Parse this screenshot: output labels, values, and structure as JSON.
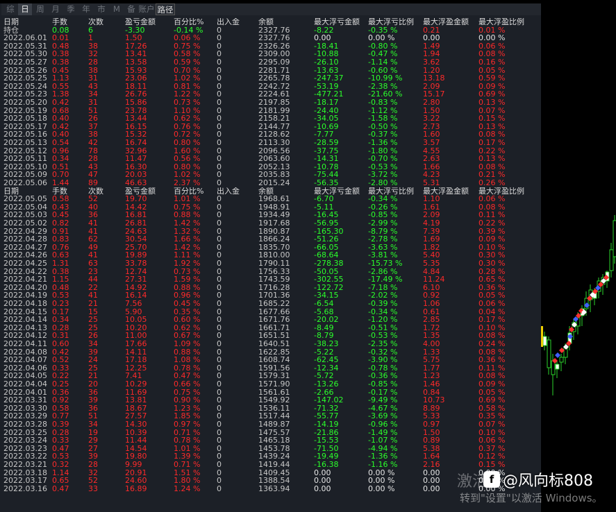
{
  "tabs": [
    {
      "label": "综",
      "active": false
    },
    {
      "label": "日",
      "active": true
    },
    {
      "label": "周",
      "active": false
    },
    {
      "label": "月",
      "active": false
    },
    {
      "label": "季",
      "active": false
    },
    {
      "label": "年",
      "active": false
    },
    {
      "label": "市",
      "active": false
    },
    {
      "label": "M",
      "active": false
    },
    {
      "label": "备",
      "active": false
    },
    {
      "label": "账户",
      "active": false
    },
    {
      "label": "路径",
      "active": false,
      "boxed": true
    }
  ],
  "columns": [
    "日期",
    "手数",
    "次数",
    "盈亏金额",
    "百分比%",
    "出入金",
    "余额",
    "最大浮亏金额",
    "最大浮亏比例",
    "最大浮盈金额",
    "最大浮盈比例"
  ],
  "holding_row": {
    "date": "持仓",
    "lots": "0.08",
    "count": "6",
    "pl": "-3.30",
    "pct": "-0.14 %",
    "io": "0",
    "balance": "2327.76",
    "max_loss": "-8.22",
    "max_loss_pct": "-0.35 %",
    "max_gain": "0.21",
    "max_gain_pct": "0.01 %"
  },
  "rows_a": [
    [
      "2022.06.01",
      "0.01",
      "1",
      "1.50",
      "0.06 %",
      "0",
      "2327.76",
      "0.00",
      "0.00 %",
      "0.00",
      "0.00 %"
    ],
    [
      "2022.05.31",
      "0.48",
      "38",
      "17.26",
      "0.75 %",
      "0",
      "2326.26",
      "-18.41",
      "-0.80 %",
      "1.49",
      "0.06 %"
    ],
    [
      "2022.05.30",
      "0.38",
      "32",
      "13.41",
      "0.58 %",
      "0",
      "2309.00",
      "-10.88",
      "-0.47 %",
      "1.94",
      "0.08 %"
    ],
    [
      "2022.05.27",
      "0.38",
      "28",
      "13.58",
      "0.59 %",
      "0",
      "2295.09",
      "-26.10",
      "-1.14 %",
      "3.62",
      "0.16 %"
    ],
    [
      "2022.05.26",
      "0.45",
      "38",
      "15.93",
      "0.70 %",
      "0",
      "2281.71",
      "-13.63",
      "-0.60 %",
      "1.20",
      "0.05 %"
    ],
    [
      "2022.05.25",
      "1.13",
      "31",
      "23.06",
      "1.02 %",
      "0",
      "2265.78",
      "-247.37",
      "-10.99 %",
      "13.18",
      "0.59 %"
    ],
    [
      "2022.05.24",
      "0.55",
      "43",
      "18.11",
      "0.81 %",
      "0",
      "2242.72",
      "-53.19",
      "-2.38 %",
      "2.09",
      "0.09 %"
    ],
    [
      "2022.05.23",
      "1.38",
      "34",
      "26.76",
      "1.22 %",
      "0",
      "2224.61",
      "-477.21",
      "-21.60 %",
      "15.17",
      "0.69 %"
    ],
    [
      "2022.05.20",
      "0.42",
      "31",
      "15.86",
      "0.73 %",
      "0",
      "2197.85",
      "-18.17",
      "-0.83 %",
      "2.80",
      "0.13 %"
    ],
    [
      "2022.05.19",
      "0.68",
      "51",
      "23.78",
      "1.10 %",
      "0",
      "2181.99",
      "-24.40",
      "-1.12 %",
      "1.50",
      "0.07 %"
    ],
    [
      "2022.05.18",
      "0.40",
      "26",
      "13.44",
      "0.62 %",
      "0",
      "2158.21",
      "-34.05",
      "-1.58 %",
      "3.22",
      "0.15 %"
    ],
    [
      "2022.05.17",
      "0.42",
      "37",
      "16.15",
      "0.76 %",
      "0",
      "2144.77",
      "-10.69",
      "-0.50 %",
      "2.73",
      "0.13 %"
    ],
    [
      "2022.05.16",
      "0.40",
      "38",
      "15.32",
      "0.72 %",
      "0",
      "2128.62",
      "-7.77",
      "-0.37 %",
      "1.60",
      "0.08 %"
    ],
    [
      "2022.05.13",
      "0.54",
      "42",
      "16.74",
      "0.80 %",
      "0",
      "2113.30",
      "-28.59",
      "-1.36 %",
      "3.57",
      "0.17 %"
    ],
    [
      "2022.05.12",
      "0.96",
      "78",
      "32.96",
      "1.60 %",
      "0",
      "2096.56",
      "-37.75",
      "-1.80 %",
      "4.55",
      "0.22 %"
    ],
    [
      "2022.05.11",
      "0.34",
      "28",
      "11.47",
      "0.56 %",
      "0",
      "2063.60",
      "-14.31",
      "-0.70 %",
      "2.63",
      "0.13 %"
    ],
    [
      "2022.05.10",
      "0.51",
      "43",
      "16.30",
      "0.80 %",
      "0",
      "2052.13",
      "-10.78",
      "-0.53 %",
      "1.66",
      "0.08 %"
    ],
    [
      "2022.05.09",
      "0.70",
      "47",
      "20.03",
      "1.02 %",
      "0",
      "2035.83",
      "-75.44",
      "-3.72 %",
      "4.23",
      "0.21 %"
    ],
    [
      "2022.05.06",
      "1.44",
      "89",
      "46.63",
      "2.37 %",
      "0",
      "2015.24",
      "-56.35",
      "-2.80 %",
      "5.31",
      "0.26 %"
    ]
  ],
  "rows_b": [
    [
      "2022.05.05",
      "0.58",
      "52",
      "19.70",
      "1.01 %",
      "0",
      "1968.61",
      "-6.70",
      "-0.34 %",
      "1.10",
      "0.06 %"
    ],
    [
      "2022.05.04",
      "0.43",
      "40",
      "14.42",
      "0.75 %",
      "0",
      "1948.91",
      "-5.11",
      "-0.26 %",
      "1.61",
      "0.08 %"
    ],
    [
      "2022.05.03",
      "0.45",
      "36",
      "16.81",
      "0.88 %",
      "0",
      "1934.49",
      "-16.45",
      "-0.85 %",
      "2.09",
      "0.11 %"
    ],
    [
      "2022.05.02",
      "0.82",
      "41",
      "26.81",
      "1.42 %",
      "0",
      "1917.68",
      "-56.95",
      "-2.99 %",
      "4.19",
      "0.22 %"
    ],
    [
      "2022.04.29",
      "0.91",
      "41",
      "24.63",
      "1.32 %",
      "0",
      "1890.87",
      "-165.30",
      "-8.79 %",
      "7.39",
      "0.39 %"
    ],
    [
      "2022.04.28",
      "0.83",
      "62",
      "30.54",
      "1.66 %",
      "0",
      "1866.24",
      "-51.26",
      "-2.78 %",
      "1.69",
      "0.09 %"
    ],
    [
      "2022.04.27",
      "0.76",
      "49",
      "25.70",
      "1.42 %",
      "0",
      "1835.70",
      "-66.05",
      "-3.63 %",
      "1.82",
      "0.10 %"
    ],
    [
      "2022.04.26",
      "0.63",
      "41",
      "19.89",
      "1.11 %",
      "0",
      "1810.00",
      "-68.64",
      "-3.81 %",
      "5.40",
      "0.30 %"
    ],
    [
      "2022.04.25",
      "1.31",
      "63",
      "33.78",
      "1.92 %",
      "0",
      "1790.11",
      "-278.38",
      "-15.73 %",
      "5.35",
      "0.30 %"
    ],
    [
      "2022.04.22",
      "0.38",
      "23",
      "12.74",
      "0.73 %",
      "0",
      "1756.33",
      "-50.05",
      "-2.86 %",
      "4.84",
      "0.28 %"
    ],
    [
      "2022.04.21",
      "1.15",
      "44",
      "27.31",
      "1.59 %",
      "0",
      "1743.59",
      "-302.55",
      "-17.49 %",
      "11.24",
      "0.65 %"
    ],
    [
      "2022.04.20",
      "0.48",
      "22",
      "14.92",
      "0.88 %",
      "0",
      "1716.28",
      "-122.72",
      "-7.18 %",
      "6.10",
      "0.36 %"
    ],
    [
      "2022.04.19",
      "0.53",
      "41",
      "16.14",
      "0.96 %",
      "0",
      "1701.36",
      "-34.15",
      "-2.02 %",
      "0.92",
      "0.05 %"
    ],
    [
      "2022.04.18",
      "0.23",
      "21",
      "7.56",
      "0.45 %",
      "0",
      "1685.22",
      "-6.54",
      "-0.39 %",
      "1.06",
      "0.06 %"
    ],
    [
      "2022.04.15",
      "0.17",
      "15",
      "5.90",
      "0.35 %",
      "0",
      "1677.66",
      "-5.68",
      "-0.34 %",
      "0.61",
      "0.04 %"
    ],
    [
      "2022.04.14",
      "0.34",
      "25",
      "10.05",
      "0.60 %",
      "0",
      "1671.76",
      "-20.02",
      "-1.20 %",
      "2.85",
      "0.17 %"
    ],
    [
      "2022.04.13",
      "0.28",
      "25",
      "10.20",
      "0.62 %",
      "0",
      "1661.71",
      "-8.49",
      "-0.51 %",
      "1.72",
      "0.10 %"
    ],
    [
      "2022.04.12",
      "0.31",
      "26",
      "11.00",
      "0.67 %",
      "0",
      "1651.51",
      "-8.79",
      "-0.53 %",
      "1.35",
      "0.08 %"
    ],
    [
      "2022.04.11",
      "0.60",
      "34",
      "17.66",
      "1.09 %",
      "0",
      "1640.51",
      "-38.23",
      "-2.35 %",
      "4.00",
      "0.24 %"
    ],
    [
      "2022.04.08",
      "0.42",
      "39",
      "14.11",
      "0.88 %",
      "0",
      "1622.85",
      "-5.22",
      "-0.32 %",
      "1.33",
      "0.08 %"
    ],
    [
      "2022.04.07",
      "0.52",
      "24",
      "17.18",
      "1.08 %",
      "0",
      "1608.74",
      "-62.45",
      "-3.90 %",
      "5.75",
      "0.36 %"
    ],
    [
      "2022.04.06",
      "0.33",
      "25",
      "12.25",
      "0.78 %",
      "0",
      "1591.56",
      "-12.34",
      "-0.78 %",
      "1.77",
      "0.11 %"
    ],
    [
      "2022.04.05",
      "0.22",
      "21",
      "7.41",
      "0.47 %",
      "0",
      "1579.31",
      "-5.72",
      "-0.36 %",
      "1.23",
      "0.08 %"
    ],
    [
      "2022.04.04",
      "0.25",
      "20",
      "10.29",
      "0.66 %",
      "0",
      "1571.90",
      "-13.26",
      "-0.85 %",
      "1.46",
      "0.09 %"
    ],
    [
      "2022.04.01",
      "0.36",
      "36",
      "11.69",
      "0.75 %",
      "0",
      "1561.61",
      "-2.66",
      "-0.17 %",
      "0.84",
      "0.05 %"
    ],
    [
      "2022.03.31",
      "0.92",
      "39",
      "13.81",
      "0.90 %",
      "0",
      "1549.92",
      "-147.02",
      "-9.49 %",
      "10.73",
      "0.69 %"
    ],
    [
      "2022.03.30",
      "0.58",
      "36",
      "18.67",
      "1.23 %",
      "0",
      "1536.11",
      "-71.32",
      "-4.67 %",
      "8.89",
      "0.58 %"
    ],
    [
      "2022.03.29",
      "0.77",
      "51",
      "27.57",
      "1.85 %",
      "0",
      "1517.44",
      "-55.77",
      "-3.69 %",
      "5.33",
      "0.35 %"
    ],
    [
      "2022.03.28",
      "0.39",
      "34",
      "14.30",
      "0.97 %",
      "0",
      "1489.87",
      "-14.19",
      "-0.96 %",
      "0.97",
      "0.07 %"
    ],
    [
      "2022.03.25",
      "0.28",
      "19",
      "10.39",
      "0.71 %",
      "0",
      "1475.57",
      "-21.86",
      "-1.49 %",
      "1.50",
      "0.10 %"
    ],
    [
      "2022.03.24",
      "0.33",
      "29",
      "11.44",
      "0.78 %",
      "0",
      "1465.18",
      "-15.53",
      "-1.07 %",
      "0.89",
      "0.06 %"
    ],
    [
      "2022.03.23",
      "0.47",
      "27",
      "14.54",
      "1.01 %",
      "0",
      "1453.78",
      "-71.50",
      "-4.94 %",
      "5.38",
      "0.37 %"
    ],
    [
      "2022.03.22",
      "0.53",
      "39",
      "19.80",
      "1.39 %",
      "0",
      "1439.24",
      "-19.49",
      "-1.36 %",
      "1.64",
      "0.12 %"
    ],
    [
      "2022.03.21",
      "0.32",
      "28",
      "9.99",
      "0.71 %",
      "0",
      "1419.44",
      "-16.38",
      "-1.16 %",
      "2.16",
      "0.15 %"
    ],
    [
      "2022.03.18",
      "1.14",
      "32",
      "20.91",
      "1.51 %",
      "0",
      "1409.45",
      "0.00",
      "0.00 %",
      "0.00",
      "0.00 %"
    ],
    [
      "2022.03.17",
      "0.65",
      "52",
      "24.60",
      "1.80 %",
      "0",
      "1388.54",
      "0.00",
      "0.00 %",
      "0.00",
      "0.00 %"
    ],
    [
      "2022.03.16",
      "0.47",
      "33",
      "16.89",
      "1.24 %",
      "0",
      "1363.94",
      "0.00",
      "0.00 %",
      "0.00",
      "0.00 %"
    ]
  ],
  "overlay": {
    "watermark": "激活",
    "brand_logo": "f",
    "brand_text": "@风向标808",
    "windows_notice": "转到\"设置\"以激活 Windows。"
  },
  "colors": {
    "panel": "#1c2027",
    "positive": "#ff2a2a",
    "negative": "#2bff2b",
    "neutral": "#e6e6e6",
    "header": "#dcdcdc"
  }
}
